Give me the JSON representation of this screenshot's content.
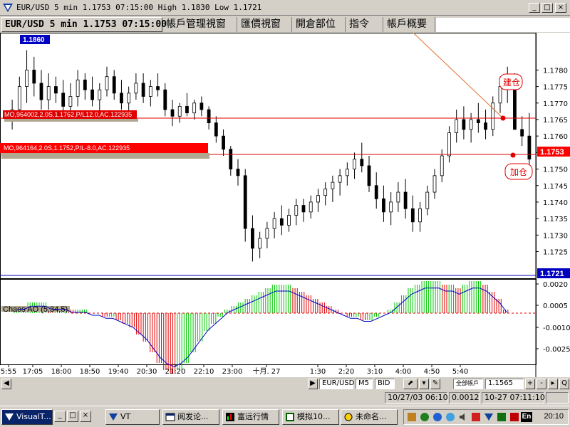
{
  "window": {
    "title": "EUR/USD 5 min 1.1753 07:15:00 High 1.1830 Low 1.1721",
    "min_label": "_",
    "max_label": "□",
    "close_label": "×"
  },
  "tabs": [
    {
      "label": "EUR/USD 5 min 1.1753 07:15:00",
      "active": true
    },
    {
      "label": "帳戶管理視窗"
    },
    {
      "label": "匯價視窗"
    },
    {
      "label": "開倉部位"
    },
    {
      "label": "指令"
    },
    {
      "label": "帳戶概要"
    }
  ],
  "price_axis": {
    "ticks": [
      "1.1780",
      "1.1775",
      "1.1770",
      "1.1765",
      "1.1760",
      "1.1755",
      "1.1750",
      "1.1745",
      "1.1740",
      "1.1735",
      "1.1730",
      "1.1725"
    ],
    "current_price": "1.1753",
    "low_price": "1.1721",
    "high_marker": "1.1860"
  },
  "orders": [
    {
      "text": "MO,964002,2.0S,1.1762,P/L12.0,AC.122935"
    },
    {
      "text": "MO,964164,2.0S,1.1752,P/L-8.0,AC.122935"
    }
  ],
  "annotations": {
    "open_label": "建仓",
    "add_label": "加仓"
  },
  "indicator": {
    "name": "Chaos AO (5,34,5)",
    "ticks": [
      "0.0020",
      "0.0005",
      "-0.0010",
      "-0.0025"
    ]
  },
  "time_axis": [
    "5:55",
    "17:05",
    "18:00",
    "18:50",
    "19:40",
    "20:30",
    "21:20",
    "22:10",
    "23:00",
    "十月. 27",
    "1:30",
    "2:20",
    "3:10",
    "4:00",
    "4:50",
    "5:40"
  ],
  "controls": {
    "symbol": "EUR/USD",
    "period": "M5",
    "side": "BID",
    "account": "全部帳戶",
    "value": "1.1565",
    "q_label": "Q"
  },
  "status": {
    "datetime1": "10/27/03 06:10",
    "value": "0.0012",
    "datetime2": "10-27 07:11:10"
  },
  "taskbar": {
    "start_label": "VisualT...",
    "tasks": [
      "VT",
      "阅发论...",
      "富远行情",
      "模拟10...",
      "未命名..."
    ],
    "lang": "En",
    "clock": "20:10"
  },
  "colors": {
    "bull": "#00c800",
    "bear": "#e00000",
    "order_line": "#e00000",
    "ao_signal": "#0000c0",
    "price_box": "#ff0000",
    "low_box": "#0000c0"
  },
  "chart_data": {
    "type": "candlestick",
    "ylim": [
      1.1718,
      1.179
    ],
    "candles": [
      [
        1.1766,
        1.1771,
        1.1762,
        1.1768
      ],
      [
        1.1768,
        1.1778,
        1.1766,
        1.1775
      ],
      [
        1.1775,
        1.1786,
        1.177,
        1.178
      ],
      [
        1.178,
        1.1784,
        1.1772,
        1.1776
      ],
      [
        1.1776,
        1.178,
        1.1768,
        1.1771
      ],
      [
        1.1771,
        1.1779,
        1.1768,
        1.1775
      ],
      [
        1.1775,
        1.1778,
        1.177,
        1.1773
      ],
      [
        1.1773,
        1.1777,
        1.1766,
        1.1769
      ],
      [
        1.1769,
        1.1776,
        1.1765,
        1.1772
      ],
      [
        1.1772,
        1.178,
        1.1769,
        1.1777
      ],
      [
        1.1777,
        1.1779,
        1.1771,
        1.1774
      ],
      [
        1.1774,
        1.1778,
        1.1769,
        1.1771
      ],
      [
        1.1771,
        1.1776,
        1.1767,
        1.1774
      ],
      [
        1.1774,
        1.1781,
        1.1772,
        1.1778
      ],
      [
        1.1778,
        1.178,
        1.1771,
        1.1773
      ],
      [
        1.1773,
        1.1777,
        1.1768,
        1.177
      ],
      [
        1.177,
        1.1775,
        1.1766,
        1.1773
      ],
      [
        1.1773,
        1.1779,
        1.1771,
        1.1776
      ],
      [
        1.1776,
        1.1779,
        1.177,
        1.1772
      ],
      [
        1.1772,
        1.1777,
        1.1769,
        1.1775
      ],
      [
        1.1775,
        1.1779,
        1.1772,
        1.1774
      ],
      [
        1.1774,
        1.1776,
        1.1766,
        1.1768
      ],
      [
        1.1768,
        1.1771,
        1.1763,
        1.1766
      ],
      [
        1.1766,
        1.177,
        1.1764,
        1.1769
      ],
      [
        1.1769,
        1.1773,
        1.1766,
        1.1767
      ],
      [
        1.1767,
        1.1771,
        1.1765,
        1.177
      ],
      [
        1.177,
        1.1772,
        1.1766,
        1.1768
      ],
      [
        1.1768,
        1.1769,
        1.1762,
        1.1764
      ],
      [
        1.1764,
        1.1766,
        1.1758,
        1.176
      ],
      [
        1.176,
        1.1762,
        1.1754,
        1.1756
      ],
      [
        1.1756,
        1.1757,
        1.1748,
        1.175
      ],
      [
        1.175,
        1.1753,
        1.1745,
        1.1748
      ],
      [
        1.1748,
        1.175,
        1.1728,
        1.1732
      ],
      [
        1.1732,
        1.1736,
        1.1722,
        1.1726
      ],
      [
        1.1726,
        1.1731,
        1.1723,
        1.1729
      ],
      [
        1.1729,
        1.1734,
        1.1726,
        1.1732
      ],
      [
        1.1732,
        1.1737,
        1.1729,
        1.1735
      ],
      [
        1.1735,
        1.1739,
        1.173,
        1.1733
      ],
      [
        1.1733,
        1.1738,
        1.1731,
        1.1736
      ],
      [
        1.1736,
        1.1741,
        1.1733,
        1.1739
      ],
      [
        1.1739,
        1.1741,
        1.1734,
        1.1737
      ],
      [
        1.1737,
        1.1742,
        1.1735,
        1.174
      ],
      [
        1.174,
        1.1744,
        1.1737,
        1.1742
      ],
      [
        1.1742,
        1.1746,
        1.1739,
        1.1744
      ],
      [
        1.1744,
        1.1748,
        1.174,
        1.1746
      ],
      [
        1.1746,
        1.175,
        1.1742,
        1.1748
      ],
      [
        1.1748,
        1.1752,
        1.1745,
        1.175
      ],
      [
        1.175,
        1.1755,
        1.1747,
        1.1753
      ],
      [
        1.1753,
        1.1758,
        1.1749,
        1.1751
      ],
      [
        1.1751,
        1.1754,
        1.1743,
        1.1745
      ],
      [
        1.1745,
        1.1749,
        1.1738,
        1.1741
      ],
      [
        1.1741,
        1.1745,
        1.1734,
        1.1737
      ],
      [
        1.1737,
        1.1743,
        1.1733,
        1.174
      ],
      [
        1.174,
        1.1746,
        1.1737,
        1.1743
      ],
      [
        1.1743,
        1.1747,
        1.1735,
        1.1738
      ],
      [
        1.1738,
        1.1742,
        1.1731,
        1.1734
      ],
      [
        1.1734,
        1.174,
        1.1731,
        1.1738
      ],
      [
        1.1738,
        1.1745,
        1.1736,
        1.1743
      ],
      [
        1.1743,
        1.175,
        1.1741,
        1.1748
      ],
      [
        1.1748,
        1.1756,
        1.1746,
        1.1754
      ],
      [
        1.1754,
        1.1763,
        1.1752,
        1.1761
      ],
      [
        1.1761,
        1.1768,
        1.1758,
        1.1765
      ],
      [
        1.1765,
        1.1769,
        1.1759,
        1.1762
      ],
      [
        1.1762,
        1.1767,
        1.1758,
        1.1765
      ],
      [
        1.1765,
        1.177,
        1.1761,
        1.1764
      ],
      [
        1.1764,
        1.1768,
        1.1759,
        1.1762
      ],
      [
        1.1762,
        1.1772,
        1.176,
        1.177
      ],
      [
        1.177,
        1.1778,
        1.1767,
        1.1775
      ],
      [
        1.1775,
        1.1781,
        1.177,
        1.1777
      ],
      [
        1.1777,
        1.1779,
        1.1766,
        1.1762
      ],
      [
        1.1762,
        1.1766,
        1.1757,
        1.176
      ],
      [
        1.176,
        1.1767,
        1.1751,
        1.1753
      ]
    ],
    "ao": [
      2,
      2,
      3,
      3,
      3,
      2,
      2,
      2,
      1,
      1,
      1,
      0,
      0,
      -1,
      -1,
      -2,
      -3,
      -4,
      -6,
      -8,
      -11,
      -14,
      -16,
      -17,
      -16,
      -14,
      -11,
      -8,
      -5,
      -3,
      -1,
      1,
      2,
      3,
      4,
      5,
      6,
      7,
      8,
      8,
      8,
      7,
      6,
      5,
      4,
      3,
      2,
      1,
      0,
      -1,
      -1,
      -2,
      -2,
      -1,
      0,
      1,
      3,
      5,
      7,
      8,
      9,
      9,
      9,
      8,
      8,
      7,
      8,
      9,
      9,
      8,
      6,
      4,
      1
    ]
  }
}
